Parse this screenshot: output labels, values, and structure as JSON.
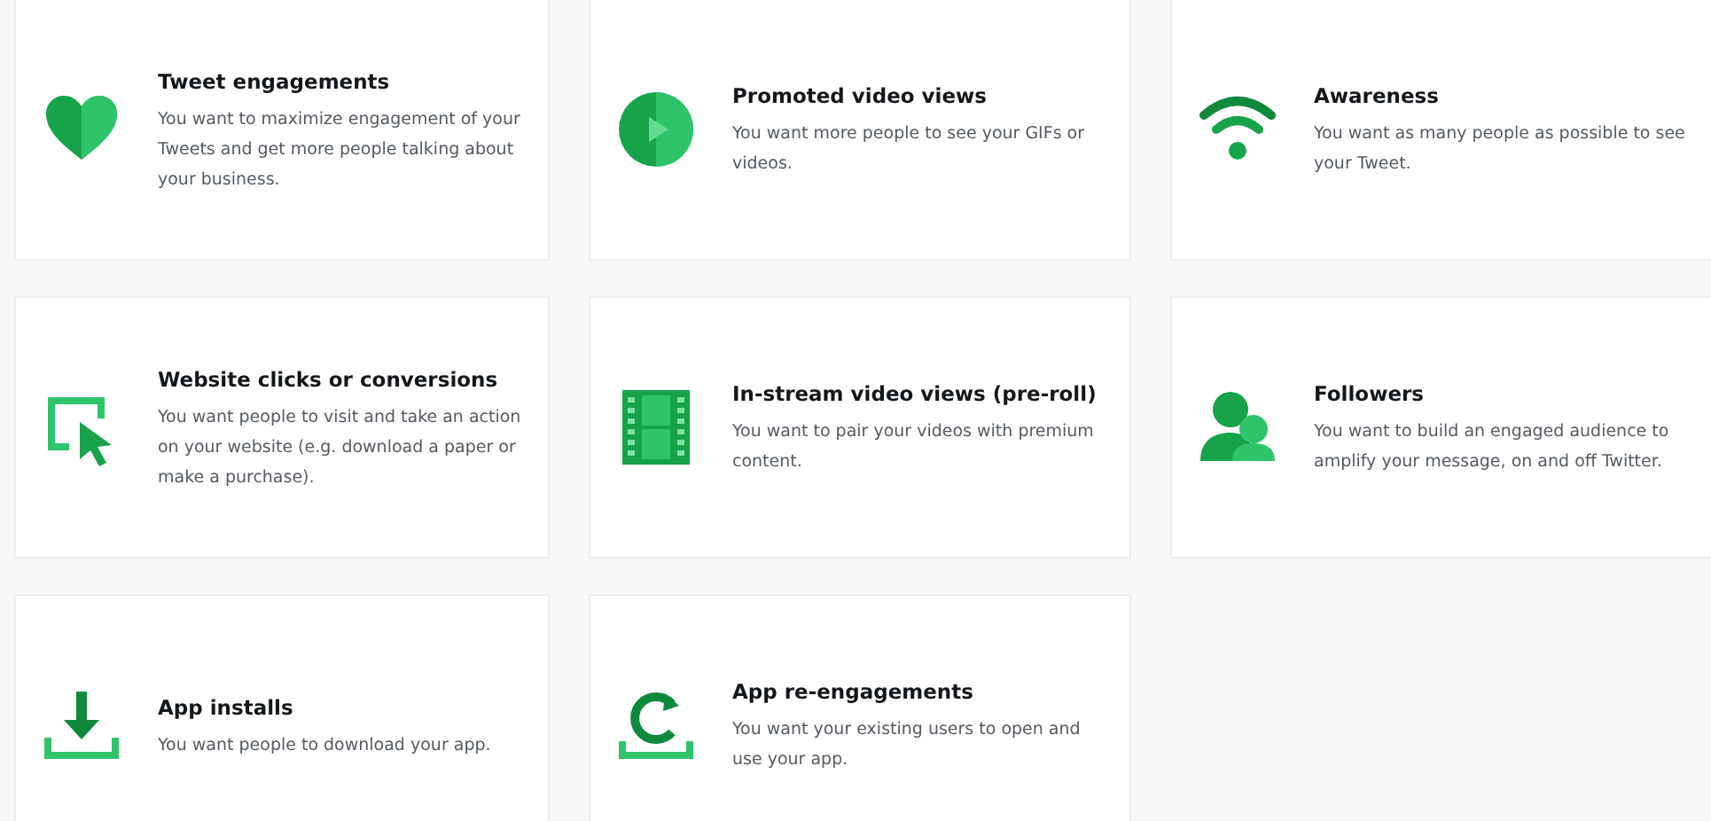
{
  "cards": [
    {
      "title": "Tweet engagements",
      "description": "You want to maximize engagement of your Tweets and get more people talking about your business."
    },
    {
      "title": "Promoted video views",
      "description": "You want more people to see your GIFs or videos."
    },
    {
      "title": "Awareness",
      "description": "You want as many people as possible to see your Tweet."
    },
    {
      "title": "Website clicks or conversions",
      "description": "You want people to visit and take an action on your website (e.g. download a paper or make a purchase)."
    },
    {
      "title": "In-stream video views (pre-roll)",
      "description": "You want to pair your videos with premium content."
    },
    {
      "title": "Followers",
      "description": "You want to build an engaged audience to amplify your message, on and off Twitter."
    },
    {
      "title": "App installs",
      "description": "You want people to download your app."
    },
    {
      "title": "App re-engagements",
      "description": "You want your existing users to open and use your app."
    }
  ]
}
